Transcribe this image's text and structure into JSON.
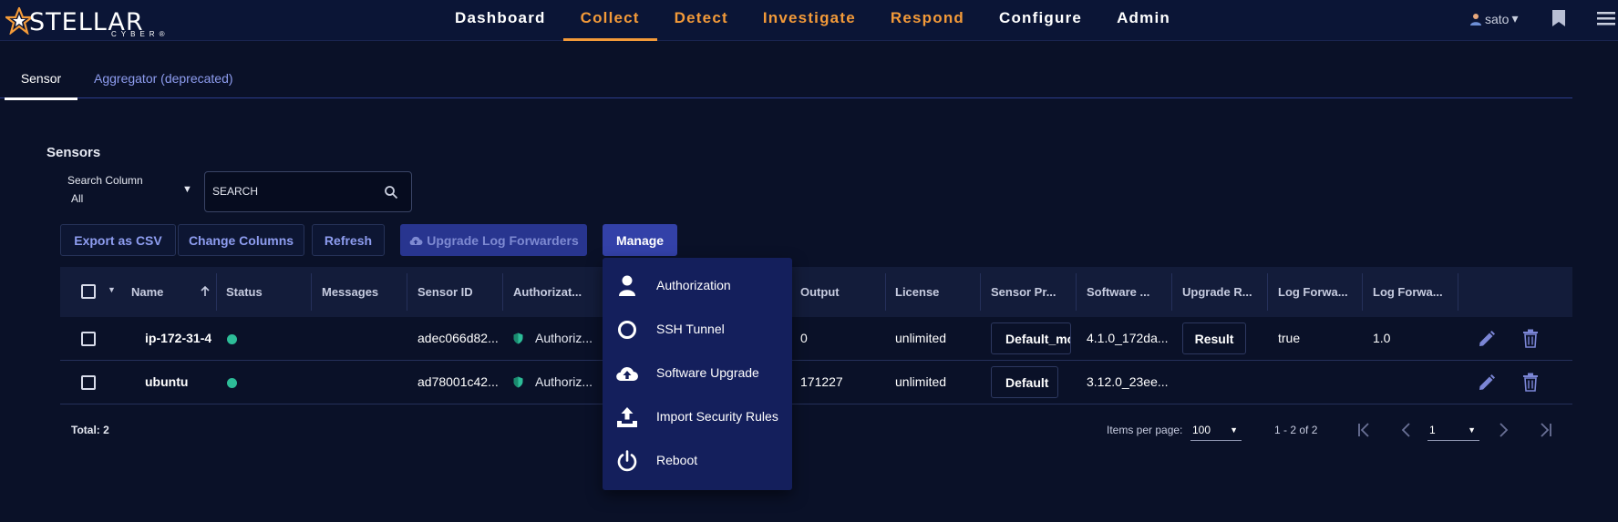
{
  "app": {
    "logo_text": "STELLAR",
    "logo_sub": "CYBER®",
    "nav": [
      {
        "label": "Dashboard",
        "color": "#ffffff"
      },
      {
        "label": "Collect",
        "color": "#f39a39",
        "active": true
      },
      {
        "label": "Detect",
        "color": "#f39a39"
      },
      {
        "label": "Investigate",
        "color": "#f39a39"
      },
      {
        "label": "Respond",
        "color": "#f39a39"
      },
      {
        "label": "Configure",
        "color": "#ffffff"
      },
      {
        "label": "Admin",
        "color": "#ffffff"
      }
    ],
    "user": "sato",
    "user_caret": "▾"
  },
  "subtabs": {
    "sensor": "Sensor",
    "aggregator": "Aggregator (deprecated)"
  },
  "section_title": "Sensors",
  "search_column": {
    "label": "Search Column",
    "value": "All"
  },
  "search": {
    "placeholder": "SEARCH"
  },
  "toolbar": {
    "export": "Export as CSV",
    "change_columns": "Change Columns",
    "refresh": "Refresh",
    "upgrade": "Upgrade Log Forwarders",
    "manage": "Manage"
  },
  "table": {
    "columns": {
      "name": "Name",
      "status": "Status",
      "messages": "Messages",
      "sensor_id": "Sensor ID",
      "authorization": "Authorizat...",
      "output": "Output",
      "license": "License",
      "sensor_profile": "Sensor Pr...",
      "software": "Software ...",
      "upgrade_result": "Upgrade R...",
      "log_forward_1": "Log Forwa...",
      "log_forward_2": "Log Forwa..."
    },
    "rows": [
      {
        "name": "ip-172-31-4",
        "sensor_id": "adec066d82...",
        "authorization": "Authoriz...",
        "output": "0",
        "license": "unlimited",
        "profile": "Default_mo",
        "software": "4.1.0_172da...",
        "upgrade_result": "Result",
        "log_forward_1": "true",
        "log_forward_2": "1.0"
      },
      {
        "name": "ubuntu",
        "sensor_id": "ad78001c42...",
        "authorization": "Authoriz...",
        "output": "171227",
        "license": "unlimited",
        "profile": "Default",
        "software": "3.12.0_23ee...",
        "upgrade_result": "",
        "log_forward_1": "",
        "log_forward_2": ""
      }
    ]
  },
  "footer": {
    "total": "Total: 2",
    "items_per_page_label": "Items per page:",
    "items_per_page": "100",
    "range": "1 - 2 of 2",
    "page": "1"
  },
  "manage_menu": [
    {
      "label": "Authorization",
      "icon": "user-icon"
    },
    {
      "label": "SSH Tunnel",
      "icon": "ring-icon"
    },
    {
      "label": "Software Upgrade",
      "icon": "cloud-upload-icon"
    },
    {
      "label": "Import Security Rules",
      "icon": "upload-tray-icon"
    },
    {
      "label": "Reboot",
      "icon": "power-icon"
    }
  ],
  "colors": {
    "accent_orange": "#f39a39",
    "status_green": "#2dbd98",
    "primary_button": "#3341a8",
    "menu_bg": "#141f5c"
  }
}
